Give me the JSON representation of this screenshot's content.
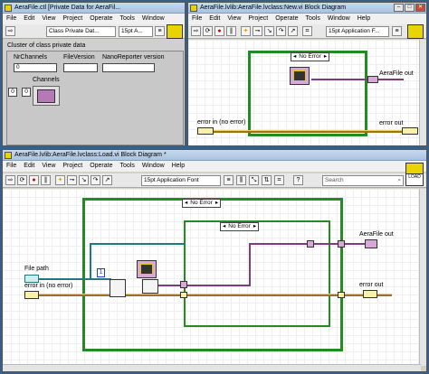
{
  "win_ctl": {
    "title": "AeraFile.ctl [Private Data for AeraFil...",
    "menu": [
      "File",
      "Edit",
      "View",
      "Project",
      "Operate",
      "Tools",
      "Window"
    ],
    "dropdown": "Class Private Dat...",
    "font_dropdown": "15pt A...",
    "cluster_label": "Cluster of class private data",
    "nrchannels_label": "NrChannels",
    "fileversion_label": "FileVersion",
    "nanoreporter_label": "NanoReporter version",
    "nrchannels_value": "0",
    "channels_label": "Channels",
    "channels_index": "0",
    "cluster_index": "0"
  },
  "win_new": {
    "title": "AeraFile.lvlib:AeraFile.lvclass:New.vi Block Diagram",
    "menu": [
      "File",
      "Edit",
      "View",
      "Project",
      "Operate",
      "Tools",
      "Window",
      "Help"
    ],
    "font_dropdown": "15pt Application F...",
    "case_selector": "No Error",
    "out_label": "AeraFile out",
    "error_in_label": "error in (no error)",
    "error_out_label": "error out"
  },
  "win_load": {
    "title": "AeraFile.lvlib:AeraFile.lvclass:Load.vi Block Diagram *",
    "menu": [
      "File",
      "Edit",
      "View",
      "Project",
      "Operate",
      "Tools",
      "Window",
      "Help"
    ],
    "font_dropdown": "15pt Application Font",
    "search_placeholder": "Search",
    "outer_case": "No Error",
    "inner_case": "No Error",
    "file_path_label": "File path",
    "error_in_label": "error in (no error)",
    "aerafile_out_label": "AeraFile out",
    "error_out_label": "error out",
    "const_value": "1",
    "icon_label": "LOAD"
  }
}
